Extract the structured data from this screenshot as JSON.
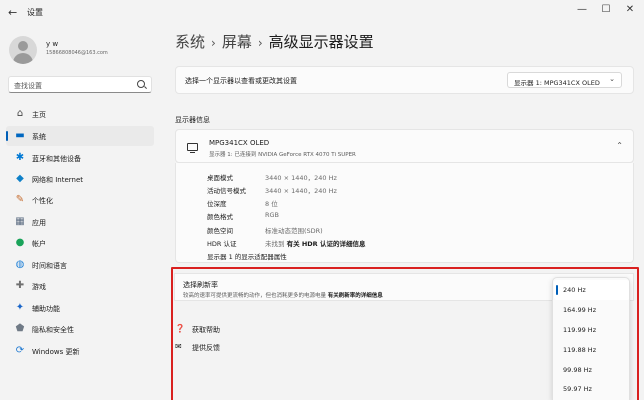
{
  "window": {
    "title": "设置",
    "back": "←",
    "minimize": "—",
    "maximize": "☐",
    "close": "✕"
  },
  "user": {
    "name": "y w",
    "email": "15866808046@163.com"
  },
  "search": {
    "placeholder": "查找设置"
  },
  "nav": [
    {
      "label": "主页",
      "icon": "home-icon",
      "glyph": "⌂",
      "color": "#444444"
    },
    {
      "label": "系统",
      "icon": "system-icon",
      "glyph": "▬",
      "color": "#0067c0",
      "active": true
    },
    {
      "label": "蓝牙和其他设备",
      "icon": "bluetooth-icon",
      "glyph": "✱",
      "color": "#0078d4"
    },
    {
      "label": "网络和 Internet",
      "icon": "wifi-icon",
      "glyph": "◆",
      "color": "#0e80c8"
    },
    {
      "label": "个性化",
      "icon": "brush-icon",
      "glyph": "✎",
      "color": "#c56a2c"
    },
    {
      "label": "应用",
      "icon": "apps-icon",
      "glyph": "▦",
      "color": "#5a6b80"
    },
    {
      "label": "帐户",
      "icon": "account-icon",
      "glyph": "●",
      "color": "#1aa35a"
    },
    {
      "label": "时间和语言",
      "icon": "globe-icon",
      "glyph": "◍",
      "color": "#1d7fd6"
    },
    {
      "label": "游戏",
      "icon": "gamepad-icon",
      "glyph": "✚",
      "color": "#707070"
    },
    {
      "label": "辅助功能",
      "icon": "accessibility-icon",
      "glyph": "✦",
      "color": "#1b66c9"
    },
    {
      "label": "隐私和安全性",
      "icon": "shield-icon",
      "glyph": "⬟",
      "color": "#707a86"
    },
    {
      "label": "Windows 更新",
      "icon": "update-icon",
      "glyph": "⟳",
      "color": "#1f79d2"
    }
  ],
  "breadcrumb": {
    "part1": "系统",
    "part2": "屏幕",
    "part3": "高级显示器设置",
    "sep": "›"
  },
  "display_select": {
    "label": "选择一个显示器以查看或更改其设置",
    "value": "显示器 1: MPG341CX OLED",
    "chevron": "⌄"
  },
  "display_info": {
    "section_title": "显示器信息",
    "monitor_name": "MPG341CX OLED",
    "monitor_sub": "显示器 1: 已连接到 NVIDIA GeForce RTX 4070 Ti SUPER",
    "chevron": "⌃",
    "rows": [
      {
        "key": "桌面模式",
        "value": "3440 × 1440，240 Hz"
      },
      {
        "key": "活动信号模式",
        "value": "3440 × 1440，240 Hz"
      },
      {
        "key": "位深度",
        "value": "8 位"
      },
      {
        "key": "颜色格式",
        "value": "RGB"
      },
      {
        "key": "颜色空间",
        "value": "标准动态范围(SDR)"
      }
    ],
    "hdr_key": "HDR 认证",
    "hdr_value": "未找到",
    "hdr_link": "有关 HDR 认证的详细信息",
    "adapter_link": "显示器 1 的显示适配器属性"
  },
  "refresh_rate": {
    "title": "选择刷新率",
    "desc": "较高的速率可提供更流畅的动作，但也消耗更多的电源电量",
    "link": "有关刷新率的详细信息",
    "options": [
      "240 Hz",
      "164.99 Hz",
      "119.99 Hz",
      "119.88 Hz",
      "99.98 Hz",
      "59.97 Hz"
    ],
    "selected_index": 0
  },
  "help": {
    "get_help": "获取帮助",
    "feedback": "提供反馈"
  },
  "colors": {
    "accent": "#005fb8",
    "highlight": "#d9201f",
    "background": "#f3f3f3"
  }
}
